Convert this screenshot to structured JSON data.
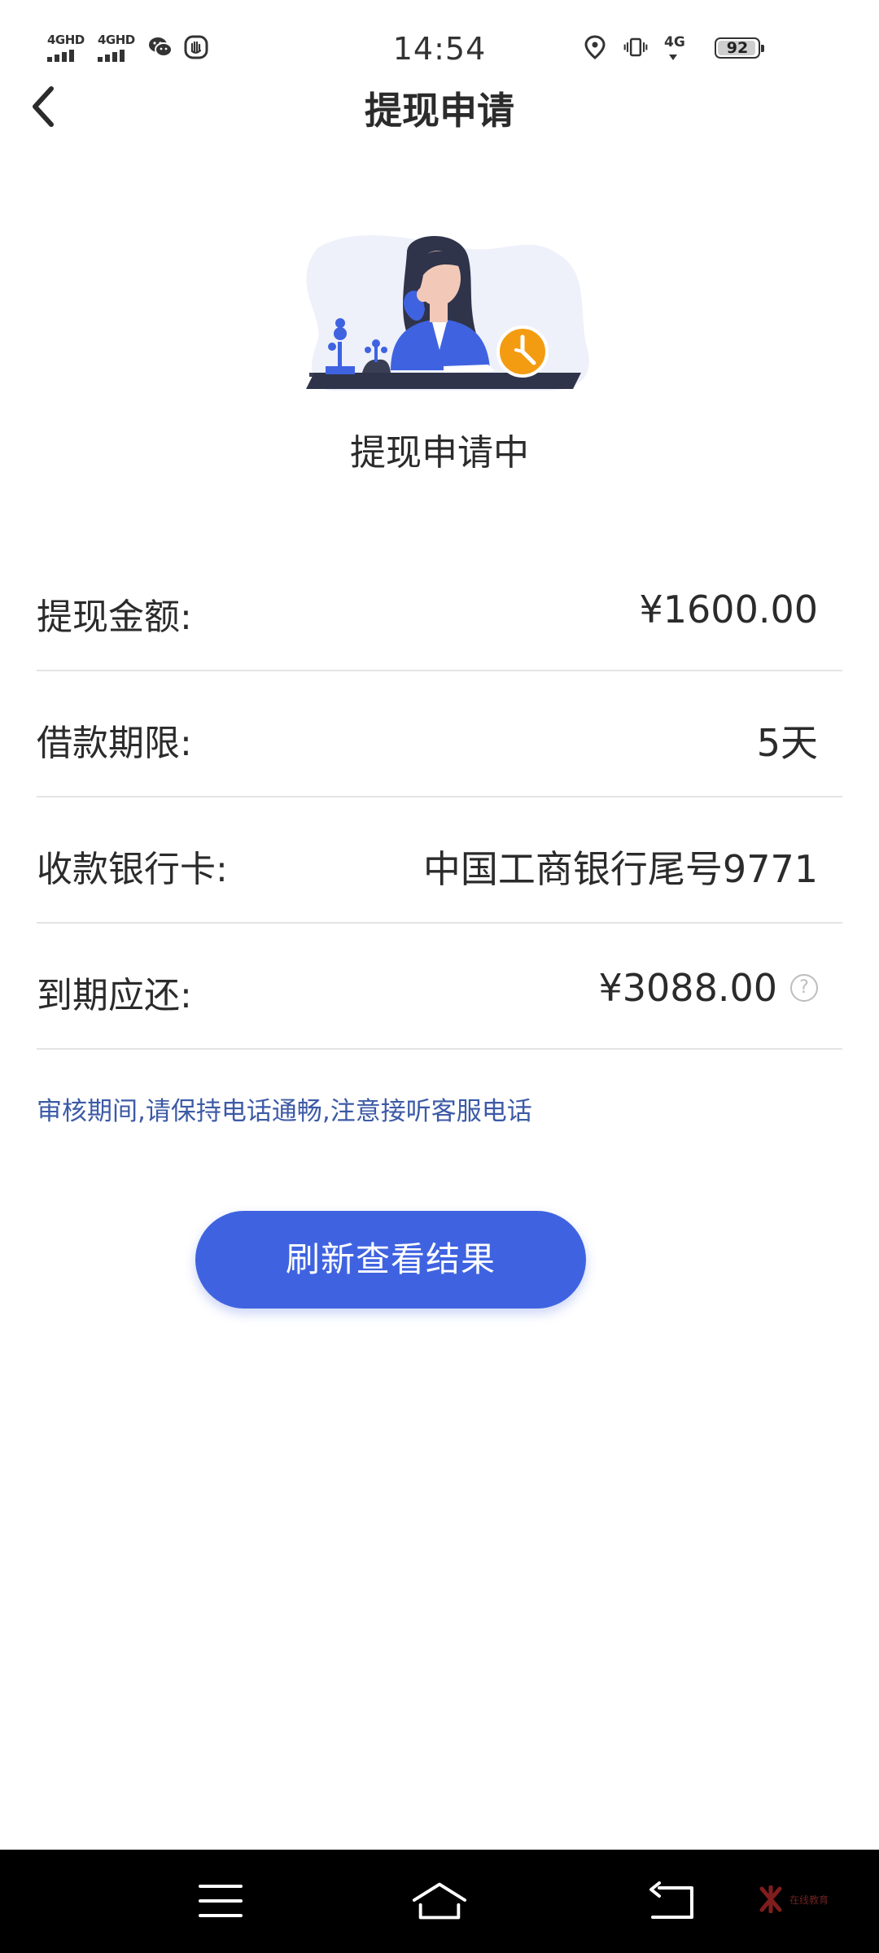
{
  "status_bar": {
    "left_network_1": "4GHD",
    "left_network_2": "4GHD",
    "time": "14:54",
    "right_network": "4G",
    "battery_level": "92",
    "icons": [
      "wechat-icon",
      "shield-icon",
      "location-icon",
      "vibrate-icon"
    ]
  },
  "header": {
    "title": "提现申请",
    "back_icon": "chevron-left-icon"
  },
  "illustration": {
    "accent_color": "#f39c12",
    "primary_color": "#3f63e0"
  },
  "status": {
    "text": "提现申请中"
  },
  "info": {
    "rows": [
      {
        "label": "提现金额:",
        "value": "¥1600.00"
      },
      {
        "label": "借款期限:",
        "value": "5天"
      },
      {
        "label": "收款银行卡:",
        "value": "中国工商银行尾号9771"
      },
      {
        "label": "到期应还:",
        "value": "¥3088.00",
        "help_icon": "question-circle-icon"
      }
    ]
  },
  "notice": {
    "text": "审核期间,请保持电话通畅,注意接听客服电话"
  },
  "actions": {
    "refresh_label": "刷新查看结果"
  },
  "nav_bar": {
    "buttons": [
      "menu-icon",
      "home-icon",
      "back-icon"
    ],
    "watermark": "在线教育"
  },
  "colors": {
    "accent": "#3f63e0",
    "notice": "#3c5aa6",
    "divider": "#e4e4e4"
  }
}
